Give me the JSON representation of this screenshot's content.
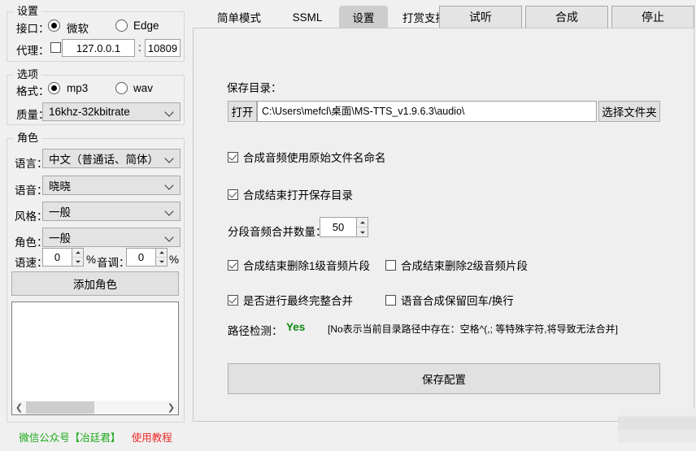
{
  "left": {
    "settings_group": {
      "title": "设置",
      "interface_label": "接口：",
      "radio_microsoft": "微软",
      "radio_edge": "Edge",
      "proxy_label": "代理：",
      "proxy_host": "127.0.0.1",
      "proxy_colon": ":",
      "proxy_port": "10809"
    },
    "options_group": {
      "title": "选项",
      "format_label": "格式：",
      "radio_mp3": "mp3",
      "radio_wav": "wav",
      "quality_label": "质量：",
      "quality_value": "16khz-32kbitrate"
    },
    "role_group": {
      "title": "角色",
      "language_label": "语言：",
      "language_value": "中文（普通话、简体）",
      "voice_label": "语音：",
      "voice_value": "晓晓",
      "style_label": "风格：",
      "style_value": "一般",
      "role_label": "角色：",
      "role_value": "一般",
      "rate_label": "语速：",
      "rate_value": "0",
      "rate_unit": "%",
      "pitch_label": "音调：",
      "pitch_value": "0",
      "pitch_unit": "%",
      "add_role_button": "添加角色"
    },
    "scrollbar": {
      "left_arrow": "❮",
      "right_arrow": "❯"
    },
    "footer": {
      "wechat_text": "微信公众号【冶廷君】",
      "tutorial_text": "使用教程",
      "green": "#1aa818",
      "red": "#ec2a2a"
    }
  },
  "tabs": [
    {
      "label": "简单模式",
      "active": false
    },
    {
      "label": "SSML",
      "active": false
    },
    {
      "label": "设置",
      "active": true
    },
    {
      "label": "打赏支持",
      "active": false
    }
  ],
  "top_buttons": [
    {
      "label": "试听"
    },
    {
      "label": "合成"
    },
    {
      "label": "停止"
    }
  ],
  "settings": {
    "save_dir_label": "保存目录：",
    "open_button": "打开",
    "path_value": "C:\\Users\\mefcl\\桌面\\MS-TTS_v1.9.6.3\\audio\\",
    "choose_folder_button": "选择文件夹",
    "checkbox_original_name": "合成音频使用原始文件名命名",
    "checkbox_open_dir_after": "合成结束打开保存目录",
    "merge_count_label": "分段音频合并数量：",
    "merge_count_value": "50",
    "checkbox_del_level1": "合成结束删除1级音频片段",
    "checkbox_del_level2": "合成结束删除2级音频片段",
    "checkbox_final_merge": "是否进行最终完整合并",
    "checkbox_keep_newline": "语音合成保留回车/换行",
    "path_check_label": "路径检测：",
    "path_check_value": "Yes",
    "path_check_value_color": "#118811",
    "path_check_hint": "[No表示当前目录路径中存在：空格^(,; 等特殊字符,将导致无法合并]",
    "save_config_button": "保存配置"
  }
}
